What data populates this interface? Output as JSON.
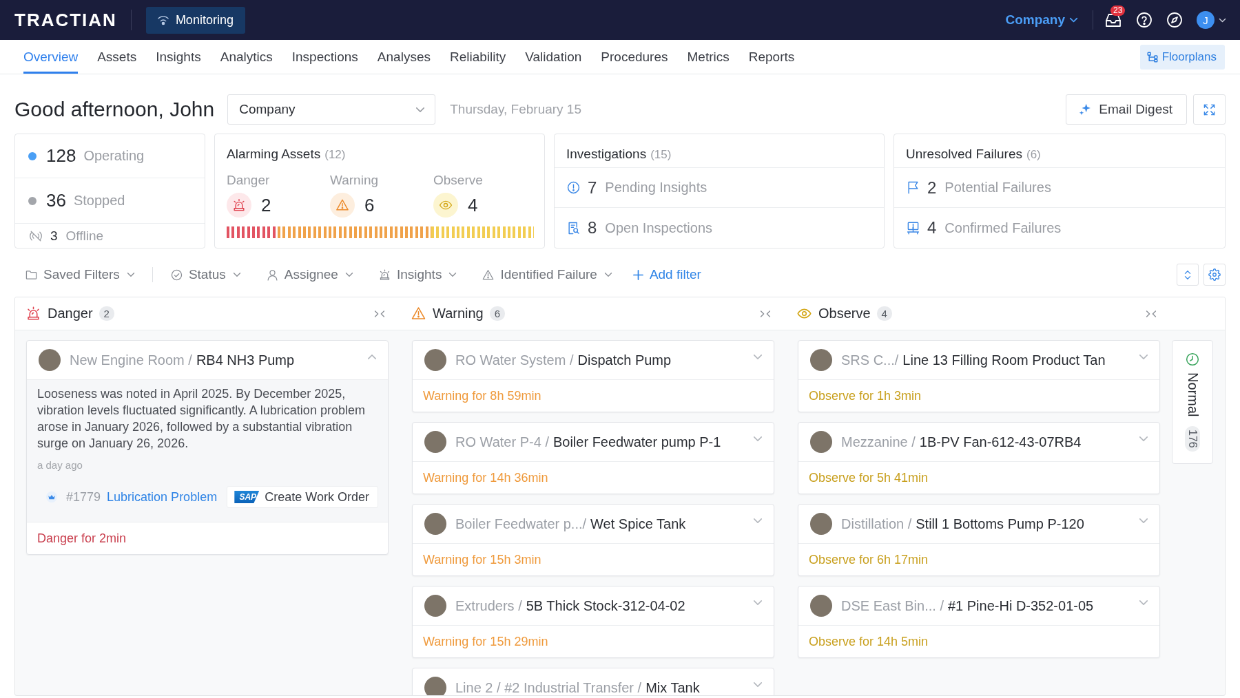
{
  "top_bar": {
    "logo": "TRACTIAN",
    "module": "Monitoring",
    "company": "Company",
    "notifications": "23",
    "avatar": "J"
  },
  "tabs": [
    {
      "label": "Overview",
      "selected": true
    },
    {
      "label": "Assets",
      "selected": false
    },
    {
      "label": "Insights",
      "selected": false
    },
    {
      "label": "Analytics",
      "selected": false
    },
    {
      "label": "Inspections",
      "selected": false
    },
    {
      "label": "Analyses",
      "selected": false
    },
    {
      "label": "Reliability",
      "selected": false
    },
    {
      "label": "Validation",
      "selected": false
    },
    {
      "label": "Procedures",
      "selected": false
    },
    {
      "label": "Metrics",
      "selected": false
    },
    {
      "label": "Reports",
      "selected": false
    }
  ],
  "floorplans_button": "Floorplans",
  "header": {
    "greeting": "Good afternoon, John",
    "company_select": "Company",
    "date": "Thursday, February 15",
    "digest_button": "Email Digest"
  },
  "asset_status": [
    {
      "kind": "dot",
      "color": "#4a9ff5",
      "count": "128",
      "label": "Operating"
    },
    {
      "kind": "dot",
      "color": "#a3a6ab",
      "count": "36",
      "label": "Stopped"
    },
    {
      "kind": "offline",
      "count": "3",
      "label": "Offline"
    }
  ],
  "alarming_assets": {
    "title": "Alarming Assets",
    "total": "(12)",
    "levels": [
      {
        "kind": "danger",
        "label": "Danger",
        "count": "2"
      },
      {
        "kind": "warning",
        "label": "Warning",
        "count": "6"
      },
      {
        "kind": "observe",
        "label": "Observe",
        "count": "4"
      }
    ]
  },
  "summaries": [
    {
      "title": "Investigations",
      "total": "(15)",
      "rows": [
        {
          "kind": "insight",
          "count": "7",
          "label": "Pending Insights"
        },
        {
          "kind": "inspection",
          "count": "8",
          "label": "Open Inspections"
        }
      ]
    },
    {
      "title": "Unresolved Failures",
      "total": "(6)",
      "rows": [
        {
          "kind": "potential",
          "count": "2",
          "label": "Potential Failures"
        },
        {
          "kind": "confirmed",
          "count": "4",
          "label": "Confirmed Failures"
        }
      ]
    }
  ],
  "filters": [
    {
      "kind": "saved",
      "label": "Saved Filters"
    },
    {
      "kind": "status",
      "label": "Status"
    },
    {
      "kind": "assignee",
      "label": "Assignee"
    },
    {
      "kind": "insights",
      "label": "Insights"
    },
    {
      "kind": "failure",
      "label": "Identified Failure"
    }
  ],
  "add_filter": "Add filter",
  "board": {
    "columns": [
      {
        "kind": "danger",
        "title": "Danger",
        "count": "2",
        "cards": [
          {
            "location": "New Engine Room /",
            "asset": "RB4 NH3 Pump",
            "expanded": true,
            "description": "Looseness was noted in April 2025. By December 2025, vibration levels fluctuated significantly. A lubrication problem arose in January 2026, followed by a substantial vibration surge on January 26, 2026.",
            "time": "a day ago",
            "insight": {
              "number": "#1779",
              "title": "Lubrication Problem"
            },
            "action": {
              "logo": "SAP",
              "label": "Create Work Order"
            },
            "duration": "Danger for 2min"
          }
        ]
      },
      {
        "kind": "warning",
        "title": "Warning",
        "count": "6",
        "cards": [
          {
            "location": "RO Water System /",
            "asset": "Dispatch Pump",
            "expanded": false,
            "duration": "Warning for 8h 59min"
          },
          {
            "location": "RO Water P-4 /",
            "asset": "Boiler Feedwater pump P-1",
            "expanded": false,
            "duration": "Warning for 14h 36min"
          },
          {
            "location": "Boiler Feedwater p.../",
            "asset": "Wet Spice Tank",
            "expanded": false,
            "duration": "Warning for 15h 3min"
          },
          {
            "location": "Extruders /",
            "asset": "5B Thick Stock-312-04-02",
            "expanded": false,
            "duration": "Warning for 15h 29min"
          },
          {
            "location": "Line 2 / #2 Industrial Transfer /",
            "asset": "Mix Tank",
            "expanded": false
          }
        ]
      },
      {
        "kind": "observe",
        "title": "Observe",
        "count": "4",
        "cards": [
          {
            "location": "SRS C.../",
            "asset": "Line 13 Filling Room Product Tan",
            "expanded": false,
            "duration": "Observe for 1h 3min"
          },
          {
            "location": "Mezzanine /",
            "asset": "1B-PV Fan-612-43-07RB4",
            "expanded": false,
            "duration": "Observe for 5h 41min"
          },
          {
            "location": "Distillation /",
            "asset": "Still 1 Bottoms Pump P-120",
            "expanded": false,
            "duration": "Observe for 6h 17min"
          },
          {
            "location": "DSE East Bin... /",
            "asset": "#1 Pine-Hi D-352-01-05",
            "expanded": false,
            "duration": "Observe for 14h 5min"
          }
        ]
      }
    ],
    "normal": {
      "label": "Normal",
      "count": "176"
    }
  }
}
